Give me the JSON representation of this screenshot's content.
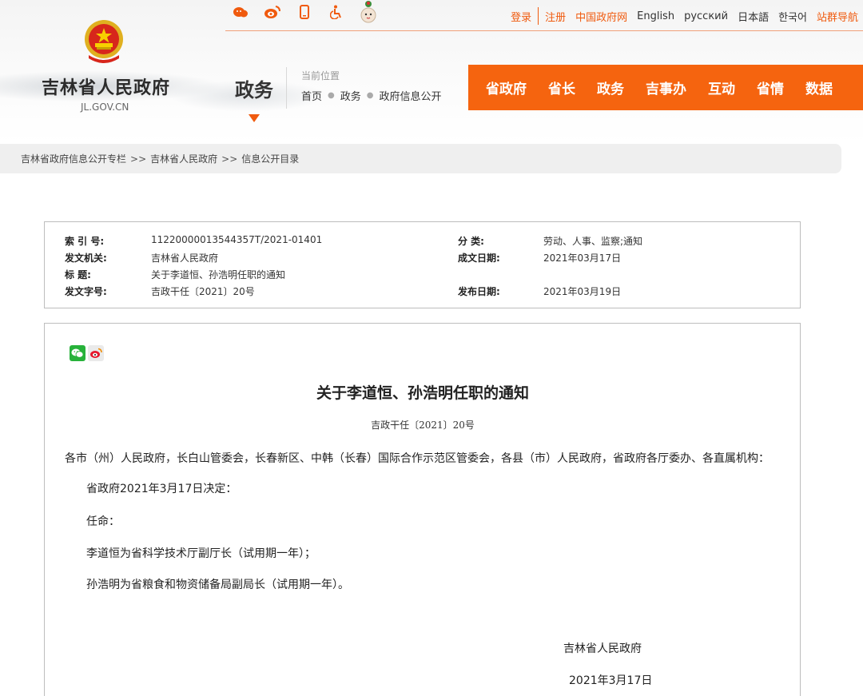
{
  "site": {
    "name": "吉林省人民政府",
    "domain": "JL.GOV.CN",
    "section": "政务"
  },
  "top_links": {
    "login": "登录",
    "register": "注册",
    "china_gov": "中国政府网",
    "english": "English",
    "russian": "русский",
    "japanese": "日本語",
    "korean": "한국어",
    "site_nav": "站群导航"
  },
  "top_icons": [
    "weibo-alt-icon",
    "weibo-icon",
    "mobile-icon",
    "accessibility-icon",
    "mascot-icon"
  ],
  "location": {
    "label": "当前位置",
    "crumbs": [
      "首页",
      "政务",
      "政府信息公开"
    ]
  },
  "main_nav": [
    "省政府",
    "省长",
    "政务",
    "吉事办",
    "互动",
    "省情",
    "数据"
  ],
  "breadcrumb": [
    "吉林省政府信息公开专栏",
    "吉林省人民政府",
    "信息公开目录"
  ],
  "breadcrumb_sep": ">>",
  "info": {
    "index_label": "索 引 号:",
    "index_value": "11220000013544357T/2021-01401",
    "category_label": "分    类:",
    "category_value": "劳动、人事、监察;通知",
    "issuer_label": "发文机关:",
    "issuer_value": "吉林省人民政府",
    "written_label": "成文日期:",
    "written_value": "2021年03月17日",
    "title_label": "标    题:",
    "title_value": "关于李道恒、孙浩明任职的通知",
    "docno_label": "发文字号:",
    "docno_value": "吉政干任〔2021〕20号",
    "published_label": "发布日期:",
    "published_value": "2021年03月19日"
  },
  "article": {
    "title": "关于李道恒、孙浩明任职的通知",
    "doc_number": "吉政干任〔2021〕20号",
    "addressee": "各市（州）人民政府，长白山管委会，长春新区、中韩（长春）国际合作示范区管委会，各县（市）人民政府，省政府各厅委办、各直属机构：",
    "p1": "省政府2021年3月17日决定：",
    "p2": "任命：",
    "p3": "李道恒为省科学技术厅副厅长（试用期一年）；",
    "p4": "孙浩明为省粮食和物资储备局副局长（试用期一年）。",
    "signature_org": "吉林省人民政府",
    "signature_date": "2021年3月17日"
  },
  "colors": {
    "brand_orange": "#f5640f",
    "wechat_green": "#27b23a"
  }
}
